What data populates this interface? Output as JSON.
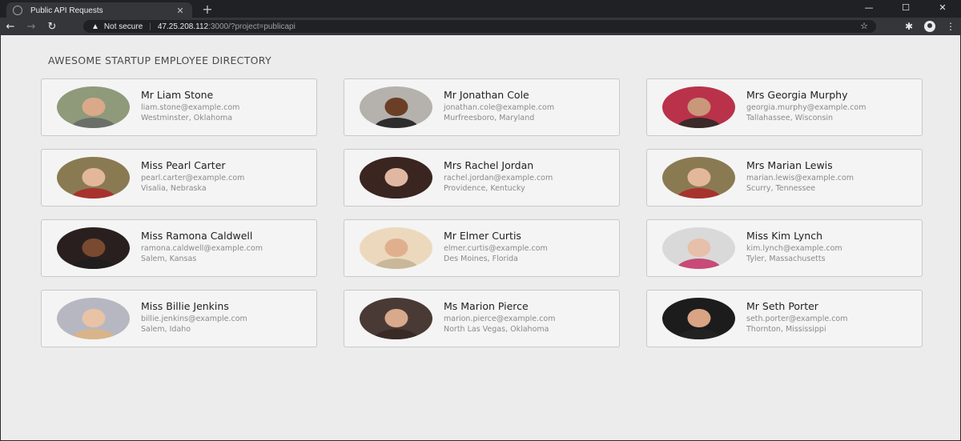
{
  "browser": {
    "tab_title": "Public API Requests",
    "tab_close": "✕",
    "new_tab": "+",
    "minimize": "—",
    "maximize": "☐",
    "close": "✕",
    "security_text": "Not secure",
    "host": "47.25.208.112",
    "path": ":3000/?project=publicapi"
  },
  "page": {
    "heading": "AWESOME STARTUP EMPLOYEE DIRECTORY"
  },
  "employees": [
    {
      "name": "Mr Liam Stone",
      "email": "liam.stone@example.com",
      "location": "Westminster, Oklahoma",
      "skin": "#d9a98a",
      "shirt": "#6b6f6a",
      "bg": "#8e9a7a"
    },
    {
      "name": "Mr Jonathan Cole",
      "email": "jonathan.cole@example.com",
      "location": "Murfreesboro, Maryland",
      "skin": "#6b3f26",
      "shirt": "#2d2d2d",
      "bg": "#b5b2ae"
    },
    {
      "name": "Mrs Georgia Murphy",
      "email": "georgia.murphy@example.com",
      "location": "Tallahassee, Wisconsin",
      "skin": "#c9977a",
      "shirt": "#3a2a2a",
      "bg": "#b9324a"
    },
    {
      "name": "Miss Pearl Carter",
      "email": "pearl.carter@example.com",
      "location": "Visalia, Nebraska",
      "skin": "#e3b89a",
      "shirt": "#a8322e",
      "bg": "#8a7a52"
    },
    {
      "name": "Mrs Rachel Jordan",
      "email": "rachel.jordan@example.com",
      "location": "Providence, Kentucky",
      "skin": "#e0b8a2",
      "shirt": "#3a2520",
      "bg": "#3a2520"
    },
    {
      "name": "Mrs Marian Lewis",
      "email": "marian.lewis@example.com",
      "location": "Scurry, Tennessee",
      "skin": "#e3b89a",
      "shirt": "#a8322e",
      "bg": "#8a7a52"
    },
    {
      "name": "Miss Ramona Caldwell",
      "email": "ramona.caldwell@example.com",
      "location": "Salem, Kansas",
      "skin": "#7a4a30",
      "shirt": "#1e1e1e",
      "bg": "#2a1f1f"
    },
    {
      "name": "Mr Elmer Curtis",
      "email": "elmer.curtis@example.com",
      "location": "Des Moines, Florida",
      "skin": "#e0b08e",
      "shirt": "#c9b79a",
      "bg": "#ecd9bd"
    },
    {
      "name": "Miss Kim Lynch",
      "email": "kim.lynch@example.com",
      "location": "Tyler, Massachusetts",
      "skin": "#e7c0aa",
      "shirt": "#c74a78",
      "bg": "#d9d9d9"
    },
    {
      "name": "Miss Billie Jenkins",
      "email": "billie.jenkins@example.com",
      "location": "Salem, Idaho",
      "skin": "#e9c3a5",
      "shirt": "#d9b48a",
      "bg": "#b7b7c2"
    },
    {
      "name": "Ms Marion Pierce",
      "email": "marion.pierce@example.com",
      "location": "North Las Vegas, Oklahoma",
      "skin": "#d8a98c",
      "shirt": "#3a2a25",
      "bg": "#4a3a35"
    },
    {
      "name": "Mr Seth Porter",
      "email": "seth.porter@example.com",
      "location": "Thornton, Mississippi",
      "skin": "#d9a384",
      "shirt": "#222222",
      "bg": "#1c1c1c"
    }
  ]
}
